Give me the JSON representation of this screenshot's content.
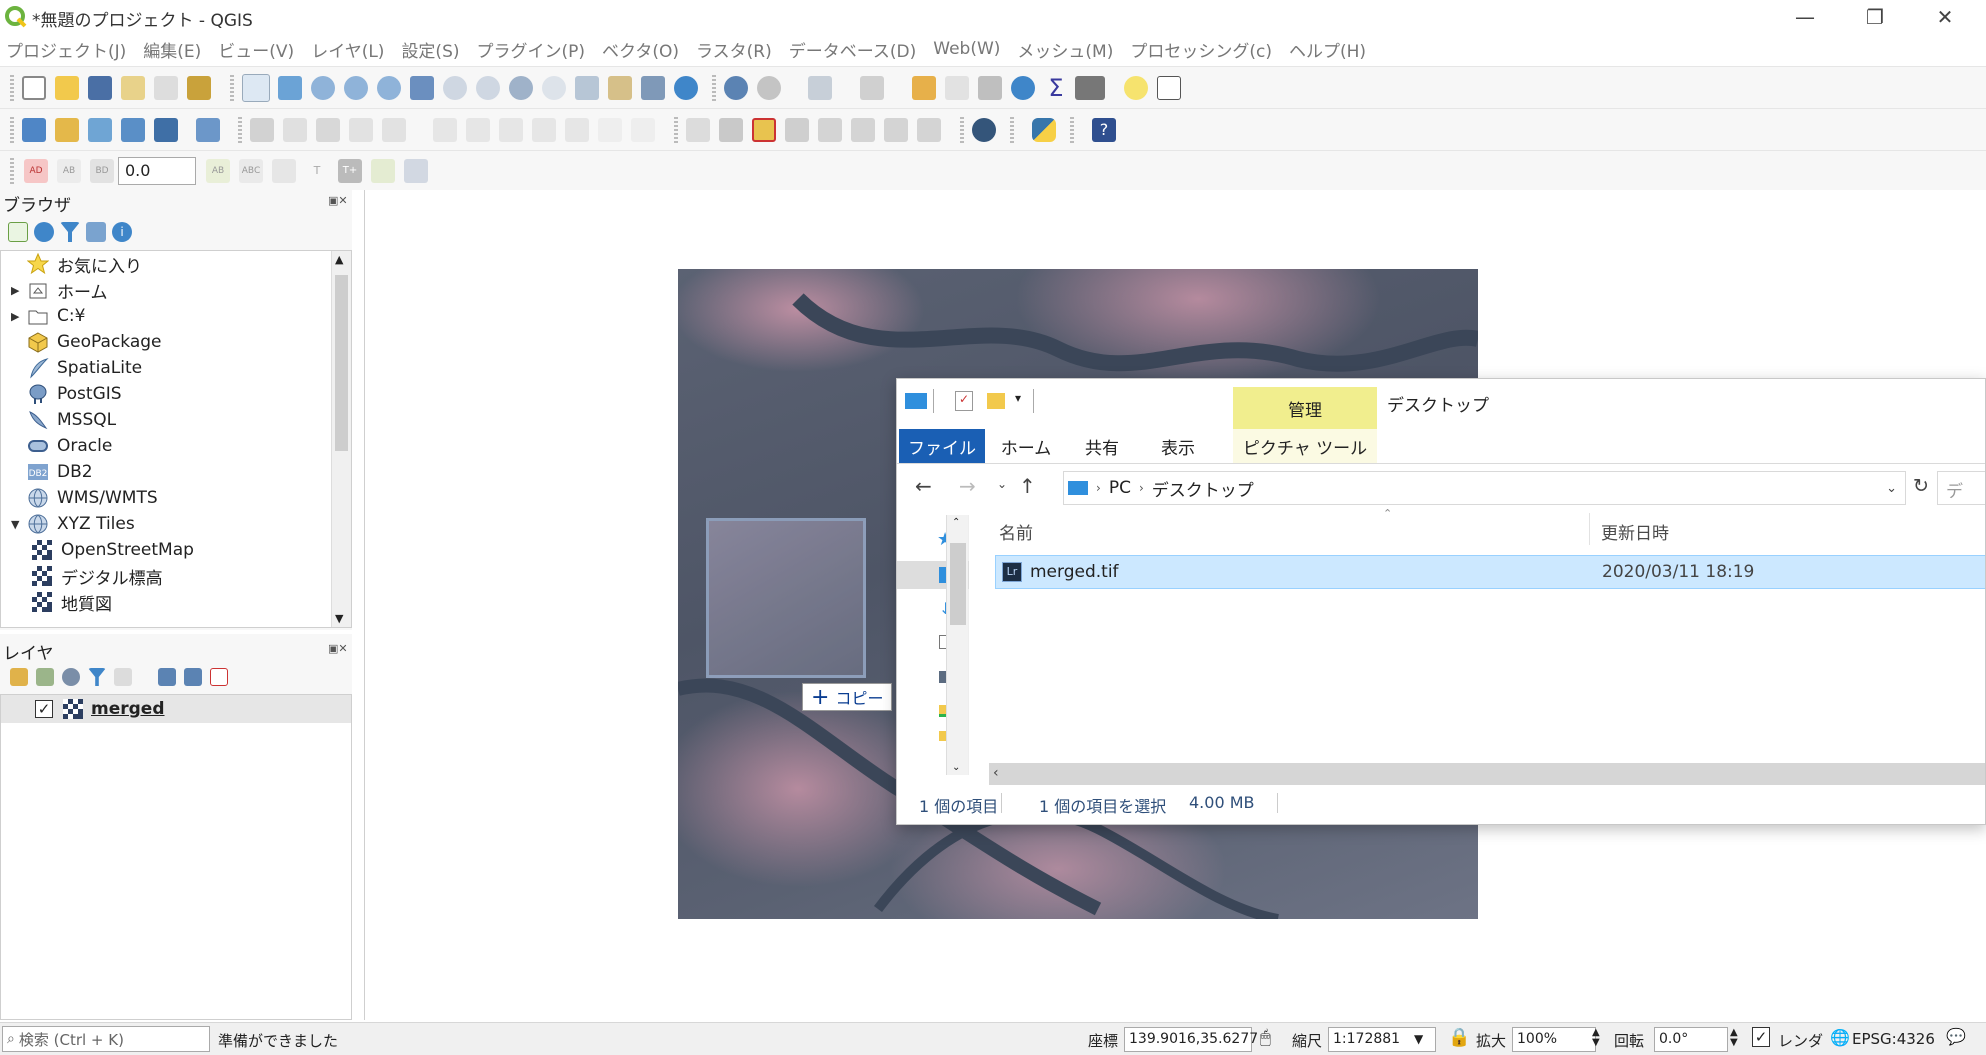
{
  "window": {
    "title": "*無題のプロジェクト - QGIS",
    "minimize_glyph": "—",
    "maximize_glyph": "❐",
    "close_glyph": "✕"
  },
  "menubar": {
    "items": [
      "プロジェクト(J)",
      "編集(E)",
      "ビュー(V)",
      "レイヤ(L)",
      "設定(S)",
      "プラグイン(P)",
      "ベクタ(O)",
      "ラスタ(R)",
      "データベース(D)",
      "Web(W)",
      "メッシュ(M)",
      "プロセッシング(c)",
      "ヘルプ(H)"
    ]
  },
  "label_toolbar": {
    "offset_value": "0.0",
    "labels": [
      "AD",
      "AB",
      "BD",
      "AB",
      "ABC",
      "T",
      "T+"
    ]
  },
  "browser_panel": {
    "title": "ブラウザ",
    "items": [
      {
        "label": "お気に入り",
        "icon": "star-icon",
        "arrow": ""
      },
      {
        "label": "ホーム",
        "icon": "home-folder-icon",
        "arrow": "▶"
      },
      {
        "label": "C:¥",
        "icon": "folder-icon",
        "arrow": "▶"
      },
      {
        "label": "GeoPackage",
        "icon": "geopackage-icon",
        "arrow": ""
      },
      {
        "label": "SpatiaLite",
        "icon": "spatialite-icon",
        "arrow": ""
      },
      {
        "label": "PostGIS",
        "icon": "postgis-icon",
        "arrow": ""
      },
      {
        "label": "MSSQL",
        "icon": "mssql-icon",
        "arrow": ""
      },
      {
        "label": "Oracle",
        "icon": "oracle-icon",
        "arrow": ""
      },
      {
        "label": "DB2",
        "icon": "db2-icon",
        "arrow": ""
      },
      {
        "label": "WMS/WMTS",
        "icon": "wms-globe-icon",
        "arrow": ""
      },
      {
        "label": "XYZ Tiles",
        "icon": "xyz-globe-icon",
        "arrow": "▼"
      },
      {
        "label": "OpenStreetMap",
        "icon": "tile-layer-icon",
        "arrow": ""
      },
      {
        "label": "デジタル標高",
        "icon": "tile-layer-icon",
        "arrow": ""
      },
      {
        "label": "地質図",
        "icon": "tile-layer-icon",
        "arrow": ""
      }
    ]
  },
  "layers_panel": {
    "title": "レイヤ",
    "layers": [
      {
        "name": "merged",
        "checked": true
      }
    ]
  },
  "drag": {
    "copy_label": "コピー",
    "plus": "+"
  },
  "explorer": {
    "context_tab": "管理",
    "window_title": "デスクトップ",
    "tabs": [
      "ファイル",
      "ホーム",
      "共有",
      "表示",
      "ピクチャ ツール"
    ],
    "breadcrumb": [
      "PC",
      "デスクトップ"
    ],
    "search_stub": "デ",
    "columns": {
      "name": "名前",
      "date": "更新日時"
    },
    "files": [
      {
        "name": "merged.tif",
        "icon_text": "Lr",
        "modified": "2020/03/11 18:19",
        "selected": true
      }
    ],
    "status_count": "1 個の項目",
    "status_selected": "1 個の項目を選択",
    "status_size": "4.00 MB"
  },
  "statusbar": {
    "search_placeholder": "検索 (Ctrl + K)",
    "ready": "準備ができました",
    "coordinate_label": "座標",
    "coordinate_value": "139.9016,35.6277",
    "scale_label": "縮尺",
    "scale_value": "1:172881",
    "magnifier_label": "拡大",
    "magnifier_value": "100%",
    "rotation_label": "回転",
    "rotation_value": "0.0°",
    "render_label": "レンダ",
    "crs": "EPSG:4326"
  }
}
